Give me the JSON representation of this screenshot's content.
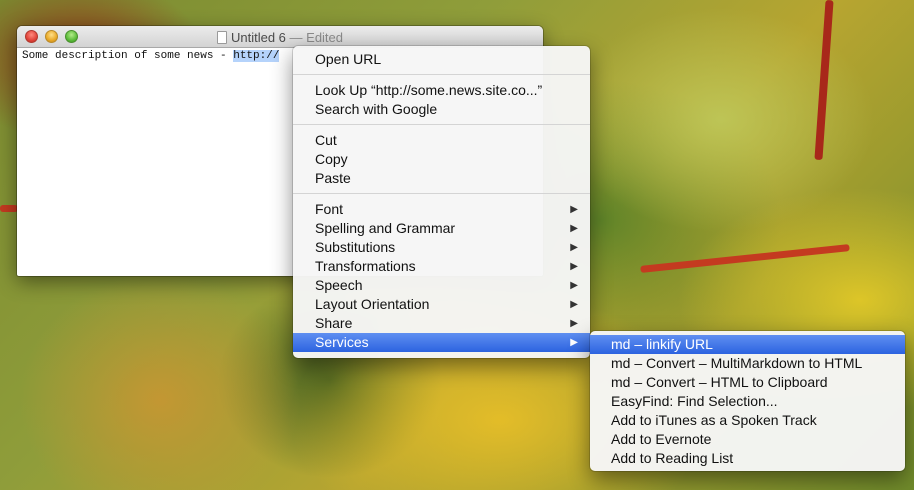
{
  "window": {
    "title": "Untitled 6",
    "status": "— Edited",
    "text_prefix": "Some description of some news - ",
    "text_selected": "http://"
  },
  "context_menu": {
    "groups": [
      [
        {
          "label": "Open URL",
          "submenu": false
        }
      ],
      [
        {
          "label": "Look Up “http://some.news.site.co...”",
          "submenu": false
        },
        {
          "label": "Search with Google",
          "submenu": false
        }
      ],
      [
        {
          "label": "Cut",
          "submenu": false
        },
        {
          "label": "Copy",
          "submenu": false
        },
        {
          "label": "Paste",
          "submenu": false
        }
      ],
      [
        {
          "label": "Font",
          "submenu": true
        },
        {
          "label": "Spelling and Grammar",
          "submenu": true
        },
        {
          "label": "Substitutions",
          "submenu": true
        },
        {
          "label": "Transformations",
          "submenu": true
        },
        {
          "label": "Speech",
          "submenu": true
        },
        {
          "label": "Layout Orientation",
          "submenu": true
        },
        {
          "label": "Share",
          "submenu": true
        },
        {
          "label": "Services",
          "submenu": true,
          "highlighted": true
        }
      ]
    ],
    "arrow_glyph": "▶"
  },
  "services_menu": {
    "items": [
      {
        "label": "md – linkify URL",
        "highlighted": true
      },
      {
        "label": "md – Convert – MultiMarkdown to HTML"
      },
      {
        "label": "md – Convert – HTML to Clipboard"
      },
      {
        "label": "EasyFind: Find Selection..."
      },
      {
        "label": "Add to iTunes as a Spoken Track"
      },
      {
        "label": "Add to Evernote"
      },
      {
        "label": "Add to Reading List"
      }
    ]
  },
  "colors": {
    "highlight": "#3a6fe6",
    "selection": "#b5d3fb"
  }
}
